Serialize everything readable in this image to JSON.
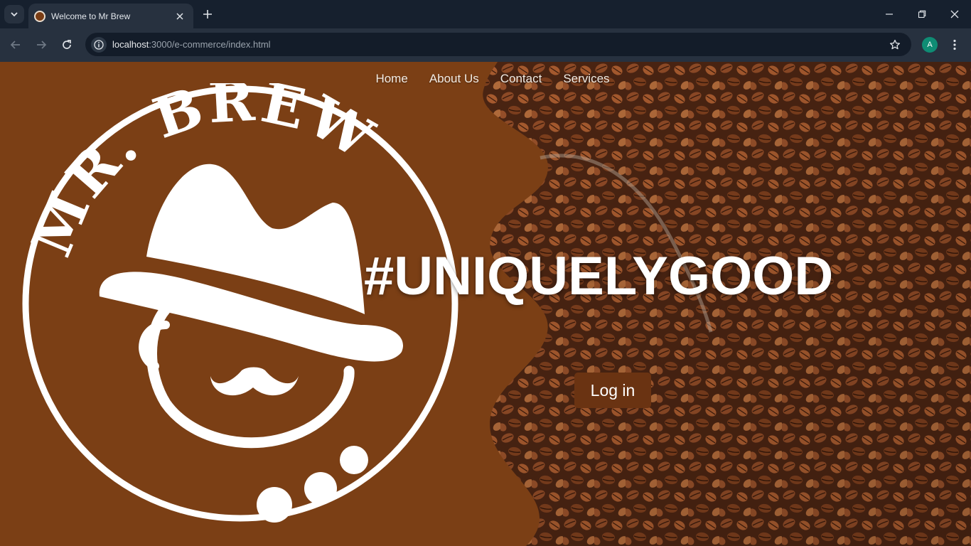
{
  "browser": {
    "tab_title": "Welcome to Mr Brew",
    "url_host": "localhost",
    "url_path": ":3000/e-commerce/index.html",
    "profile_initial": "A"
  },
  "nav": {
    "items": [
      {
        "label": "Home"
      },
      {
        "label": "About Us"
      },
      {
        "label": "Contact"
      },
      {
        "label": "Services"
      }
    ]
  },
  "logo": {
    "text": "MR. BREW",
    "color": "#7b3f15"
  },
  "hero": {
    "headline": "#UNIQUELYGOOD",
    "login_label": "Log in"
  },
  "colors": {
    "brand_brown": "#7b3f15",
    "button_brown": "#6a3312",
    "chrome_dark": "#16202e",
    "chrome_toolbar": "#27313f",
    "profile_green": "#0f8c74"
  }
}
